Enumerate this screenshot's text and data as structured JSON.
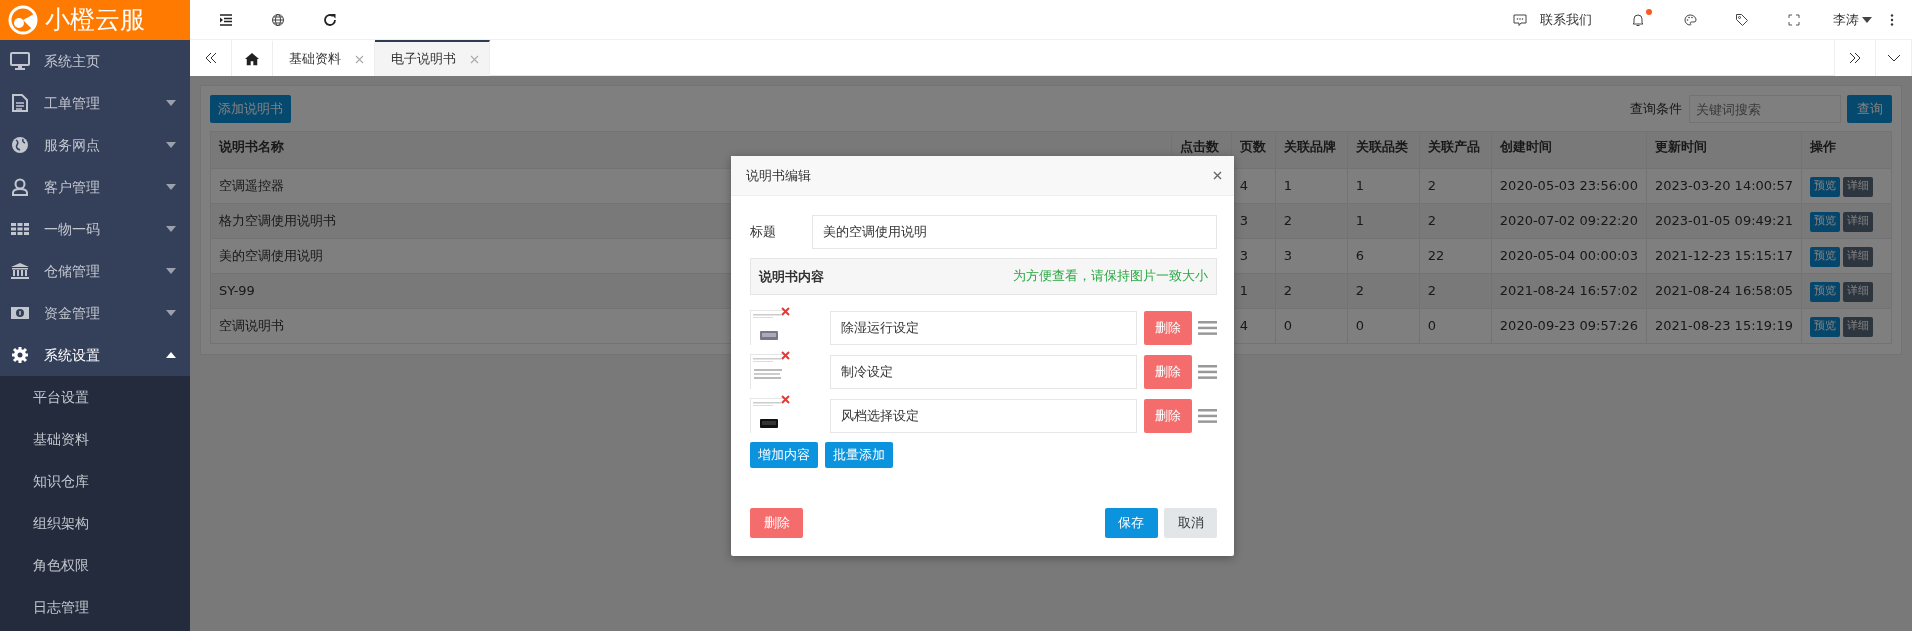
{
  "brand": {
    "name": "小橙云服"
  },
  "sidebar": {
    "items": [
      {
        "label": "系统主页"
      },
      {
        "label": "工单管理",
        "expanded": false
      },
      {
        "label": "服务网点",
        "expanded": false
      },
      {
        "label": "客户管理",
        "expanded": false
      },
      {
        "label": "一物一码",
        "expanded": false
      },
      {
        "label": "仓储管理",
        "expanded": false
      },
      {
        "label": "资金管理",
        "expanded": false
      },
      {
        "label": "系统设置",
        "expanded": true,
        "children": [
          {
            "label": "平台设置"
          },
          {
            "label": "基础资料"
          },
          {
            "label": "知识仓库"
          },
          {
            "label": "组织架构"
          },
          {
            "label": "角色权限"
          },
          {
            "label": "日志管理"
          }
        ]
      }
    ]
  },
  "topbar": {
    "contact": "联系我们",
    "unread": true,
    "user": "李涛"
  },
  "tabs": [
    {
      "kind": "home",
      "selected": false
    },
    {
      "kind": "page",
      "label": "基础资料",
      "selected": false
    },
    {
      "kind": "page",
      "label": "电子说明书",
      "selected": true
    }
  ],
  "toolbar": {
    "add_button": "添加说明书",
    "search_label": "查询条件",
    "search_placeholder": "关键词搜索",
    "search_button": "查询"
  },
  "table": {
    "columns": [
      "说明书名称",
      "点击数",
      "页数",
      "关联品牌",
      "关联品类",
      "关联产品",
      "创建时间",
      "更新时间",
      "操作"
    ],
    "rows": [
      {
        "cells": [
          "空调遥控器",
          "",
          "4",
          "1",
          "1",
          "2",
          "2020-05-03 23:56:00",
          "2023-03-20 14:00:57"
        ],
        "actions": [
          "预览",
          "详细"
        ]
      },
      {
        "cells": [
          "格力空调使用说明书",
          "",
          "3",
          "2",
          "1",
          "2",
          "2020-07-02 09:22:20",
          "2023-01-05 09:49:21"
        ],
        "actions": [
          "预览",
          "详细"
        ]
      },
      {
        "cells": [
          "美的空调使用说明",
          "",
          "3",
          "3",
          "6",
          "22",
          "2020-05-04 00:00:03",
          "2021-12-23 15:15:17"
        ],
        "actions": [
          "预览",
          "详细"
        ]
      },
      {
        "cells": [
          "SY-99",
          "",
          "1",
          "2",
          "2",
          "2",
          "2021-08-24 16:57:02",
          "2021-08-24 16:58:05"
        ],
        "actions": [
          "预览",
          "详细"
        ]
      },
      {
        "cells": [
          "空调说明书",
          "",
          "4",
          "0",
          "0",
          "0",
          "2020-09-23 09:57:26",
          "2021-08-23 15:19:19"
        ],
        "actions": [
          "预览",
          "详细"
        ]
      }
    ]
  },
  "modal": {
    "title": "说明书编辑",
    "title_label": "标题",
    "title_value": "美的空调使用说明",
    "section_title": "说明书内容",
    "section_hint": "为方便查看，请保持图片一致大小",
    "entries": [
      {
        "value": "除湿运行设定",
        "delete": "删除"
      },
      {
        "value": "制冷设定",
        "delete": "删除"
      },
      {
        "value": "风档选择设定",
        "delete": "删除"
      }
    ],
    "add_button": "增加内容",
    "batch_button": "批量添加",
    "delete_button": "删除",
    "save_button": "保存",
    "cancel_button": "取消"
  }
}
